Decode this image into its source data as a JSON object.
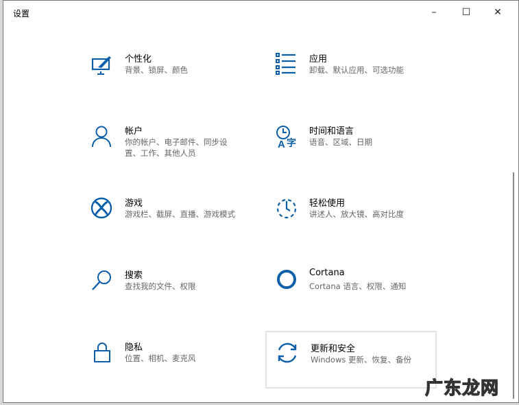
{
  "window": {
    "title": "设置"
  },
  "tiles": [
    {
      "title": "个性化",
      "subtitle": "背景、锁屏、颜色",
      "icon": "personalization-icon"
    },
    {
      "title": "应用",
      "subtitle": "卸载、默认应用、可选功能",
      "icon": "apps-icon"
    },
    {
      "title": "帐户",
      "subtitle": "你的帐户、电子邮件、同步设置、工作、其他人员",
      "icon": "account-icon"
    },
    {
      "title": "时间和语言",
      "subtitle": "语音、区域、日期",
      "icon": "time-language-icon"
    },
    {
      "title": "游戏",
      "subtitle": "游戏栏、截屏、直播、游戏模式",
      "icon": "xbox-icon"
    },
    {
      "title": "轻松使用",
      "subtitle": "讲述人、放大镜、高对比度",
      "icon": "ease-of-access-icon"
    },
    {
      "title": "搜索",
      "subtitle": "查找我的文件、权限",
      "icon": "search-icon"
    },
    {
      "title": "Cortana",
      "subtitle": "Cortana 语言、权限、通知",
      "icon": "cortana-icon"
    },
    {
      "title": "隐私",
      "subtitle": "位置、相机、麦克风",
      "icon": "lock-icon"
    },
    {
      "title": "更新和安全",
      "subtitle": "Windows 更新、恢复、备份",
      "icon": "update-icon"
    }
  ],
  "watermark": "广东龙网"
}
